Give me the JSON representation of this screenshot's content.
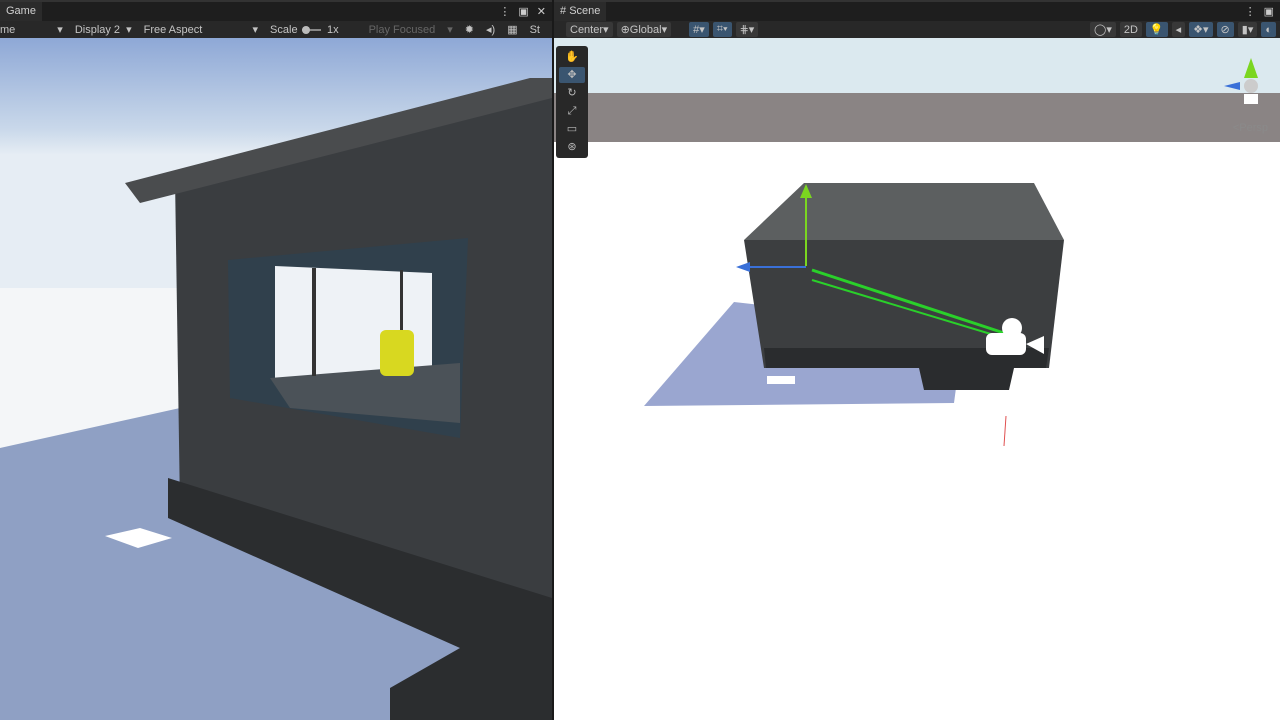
{
  "game": {
    "tab": "Game",
    "toolbar": {
      "mode": "me",
      "display": "Display 2",
      "aspect": "Free Aspect",
      "scale_label": "Scale",
      "scale_value": "1x",
      "play_mode": "Play Focused",
      "stats": "St"
    }
  },
  "scene": {
    "tab": "Scene",
    "toolbar": {
      "pivot": "Center",
      "space": "Global",
      "mode_2d": "2D"
    },
    "tools": [
      "hand-tool",
      "move-tool",
      "rotate-tool",
      "scale-tool",
      "rect-tool",
      "transform-tool"
    ],
    "selected_tool": "move-tool",
    "projection": "Persp"
  },
  "colors": {
    "editor_bg": "#282828",
    "accent": "#3a5570"
  }
}
